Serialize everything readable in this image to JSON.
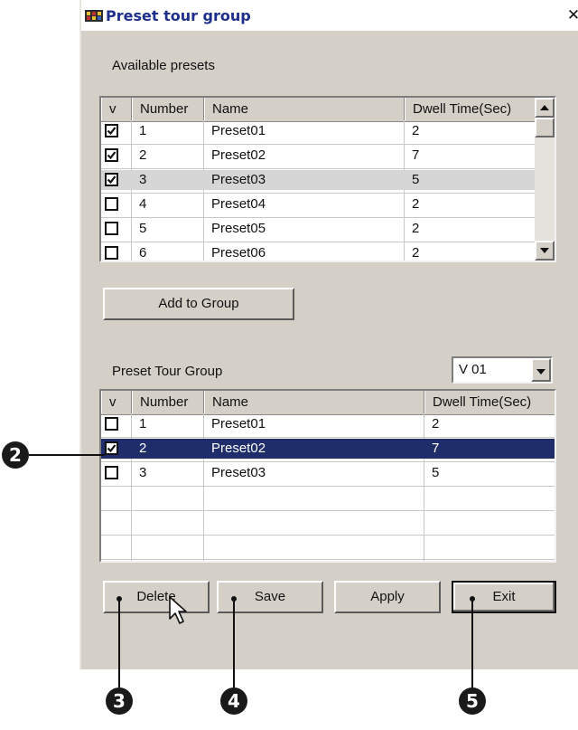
{
  "window": {
    "title": "Preset tour group",
    "close_glyph": "✕"
  },
  "available": {
    "label": "Available presets",
    "columns": [
      "v",
      "Number",
      "Name",
      "Dwell Time(Sec)"
    ],
    "rows": [
      {
        "checked": true,
        "number": "1",
        "name": "Preset01",
        "dwell": "2"
      },
      {
        "checked": true,
        "number": "2",
        "name": "Preset02",
        "dwell": "7"
      },
      {
        "checked": true,
        "number": "3",
        "name": "Preset03",
        "dwell": "5"
      },
      {
        "checked": false,
        "number": "4",
        "name": "Preset04",
        "dwell": "2"
      },
      {
        "checked": false,
        "number": "5",
        "name": "Preset05",
        "dwell": "2"
      },
      {
        "checked": false,
        "number": "6",
        "name": "Preset06",
        "dwell": "2"
      }
    ],
    "selected_row": 2
  },
  "add_button": "Add to Group",
  "group": {
    "label": "Preset Tour Group",
    "select_value": "V 01",
    "columns": [
      "v",
      "Number",
      "Name",
      "Dwell Time(Sec)"
    ],
    "rows": [
      {
        "checked": false,
        "number": "1",
        "name": "Preset01",
        "dwell": "2"
      },
      {
        "checked": true,
        "number": "2",
        "name": "Preset02",
        "dwell": "7"
      },
      {
        "checked": false,
        "number": "3",
        "name": "Preset03",
        "dwell": "5"
      }
    ],
    "selected_row": 1
  },
  "buttons": {
    "delete": "Delete",
    "save": "Save",
    "apply": "Apply",
    "exit": "Exit"
  },
  "callouts": [
    "2",
    "3",
    "4",
    "5"
  ],
  "colors": {
    "selection": "#1f2d6b",
    "title_text": "#1e2f8c",
    "dialog_bg": "#d4d0c8"
  },
  "icons": [
    "app-icon",
    "close-icon",
    "checkbox-icon",
    "scroll-up-icon",
    "scroll-down-icon",
    "dropdown-arrow-icon",
    "mouse-cursor-icon"
  ]
}
